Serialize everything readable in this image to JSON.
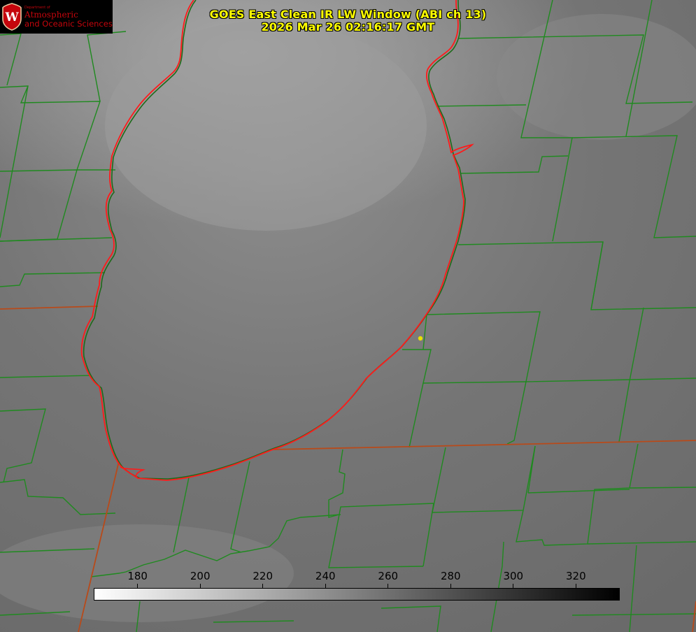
{
  "title": {
    "line1": "GOES East Clean IR LW Window (ABI ch 13)",
    "line2": "2026 Mar 26 02:16:17 GMT"
  },
  "logo": {
    "small": "Department of",
    "line1": "Atmospheric",
    "line2": "and Oceanic Sciences",
    "seal_letter": "W"
  },
  "colorbar": {
    "min": 166,
    "max": 334,
    "ticks": [
      "180",
      "200",
      "220",
      "240",
      "260",
      "280",
      "300",
      "320"
    ],
    "gradient": [
      "#ffffff",
      "#000000"
    ]
  },
  "colors": {
    "county_lines": "#1f8a1f",
    "state_lines": "#b84a1a",
    "lake_shore": "#ff1a1a",
    "marker": "#e8e000",
    "title": "#ffff00",
    "logo_red": "#c5050c"
  },
  "marker": {
    "label": "",
    "visible": true
  }
}
